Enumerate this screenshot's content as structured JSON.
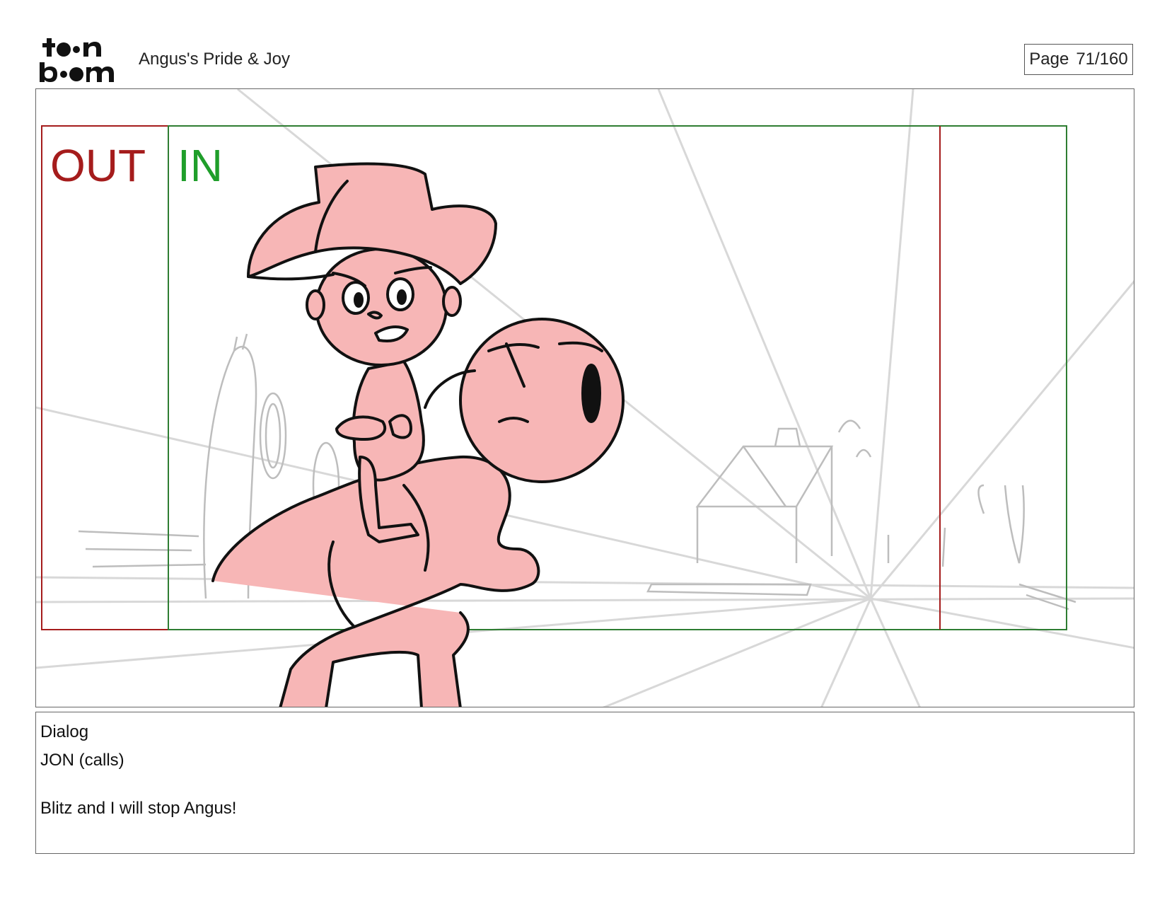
{
  "header": {
    "logo_text": "toon boom",
    "project_title": "Angus's Pride & Joy",
    "page_label": "Page",
    "page_number": "71/160"
  },
  "panel": {
    "out_label": "OUT",
    "in_label": "IN",
    "colors": {
      "out_frame": "#a51c1c",
      "in_frame": "#2e7d32",
      "character_fill": "#f7b6b6",
      "line": "#111111",
      "background_sketch": "#c8c8c8"
    }
  },
  "dialog": {
    "heading": "Dialog",
    "speaker": "JON (calls)",
    "line": "Blitz and I will stop Angus!"
  }
}
